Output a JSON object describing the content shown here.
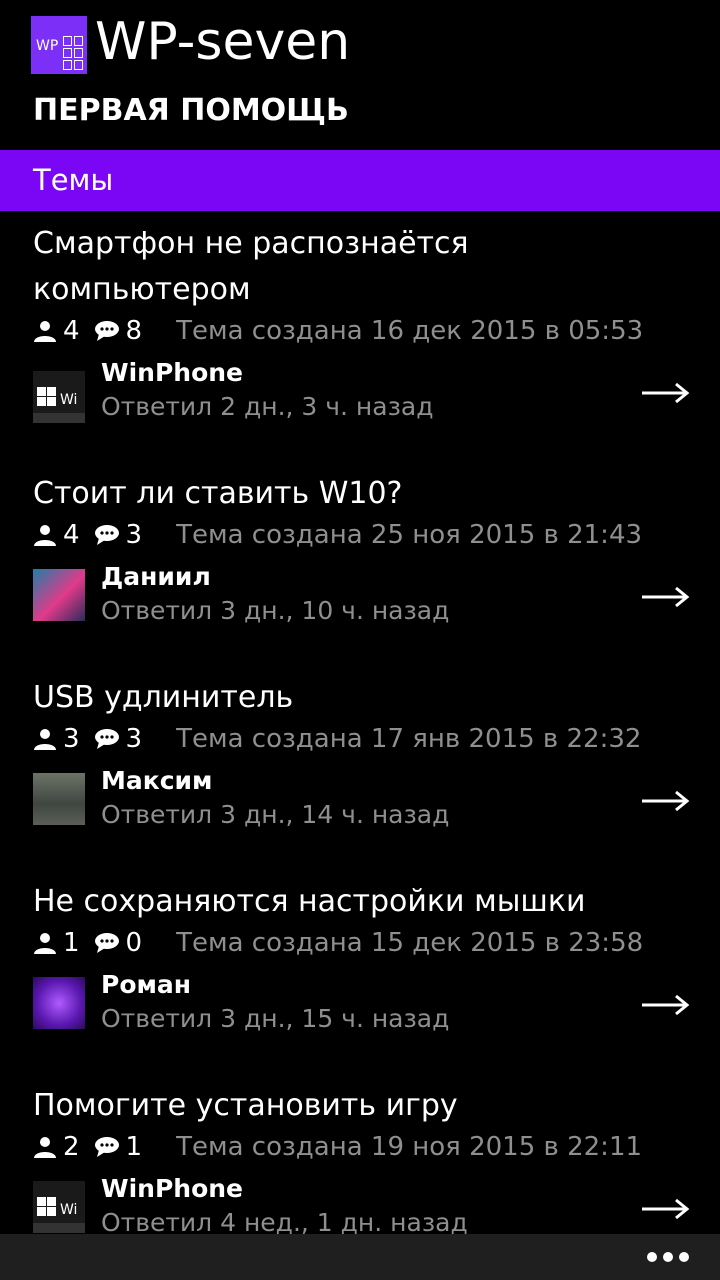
{
  "app": {
    "title": "WP-seven",
    "logo_text": "WP"
  },
  "page": {
    "title": "ПЕРВАЯ ПОМОЩЬ"
  },
  "section": {
    "label": "Темы"
  },
  "topics": [
    {
      "title": "Смартфон не распознаётся компьютером",
      "users": "4",
      "comments": "8",
      "created": "Тема создана 16 дек 2015 в 05:53",
      "author": "WinPhone",
      "replied": "Ответил 2 дн., 3 ч. назад"
    },
    {
      "title": "Стоит ли ставить W10?",
      "users": "4",
      "comments": "3",
      "created": "Тема создана 25 ноя 2015 в 21:43",
      "author": "Даниил",
      "replied": "Ответил 3 дн., 10 ч. назад"
    },
    {
      "title": "USB удлинитель",
      "users": "3",
      "comments": "3",
      "created": "Тема создана 17 янв 2015 в 22:32",
      "author": "Максим",
      "replied": "Ответил 3 дн., 14 ч. назад"
    },
    {
      "title": "Не сохраняются настройки мышки",
      "users": "1",
      "comments": "0",
      "created": "Тема создана 15 дек 2015 в 23:58",
      "author": "Роман",
      "replied": "Ответил 3 дн., 15 ч. назад"
    },
    {
      "title": "Помогите установить игру",
      "users": "2",
      "comments": "1",
      "created": "Тема создана 19 ноя 2015 в 22:11",
      "author": "WinPhone",
      "replied": "Ответил 4 нед., 1 дн. назад"
    }
  ],
  "colors": {
    "accent": "#7b05f5",
    "secondary_text": "#8f8f8f",
    "appbar": "#1f1f1f"
  },
  "icons": {
    "users": "person-icon",
    "comments": "speech-bubble-icon",
    "open": "arrow-right-icon",
    "more": "ellipsis-icon"
  }
}
